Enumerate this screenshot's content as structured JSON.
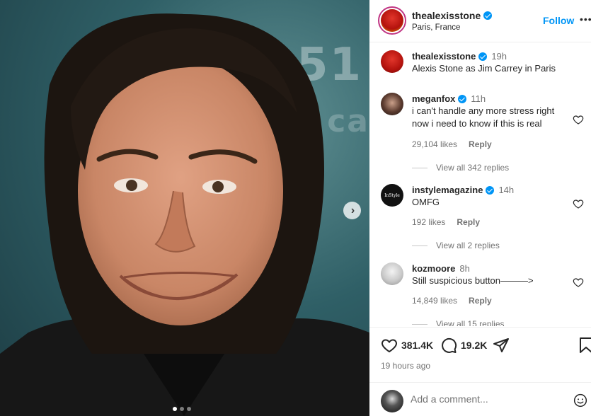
{
  "photo": {
    "background_text_1": "51",
    "background_text_2": "ca",
    "next_icon": "chevron-right-icon",
    "carousel": {
      "count": 3,
      "active_index": 0
    }
  },
  "header": {
    "username": "thealexisstone",
    "location": "Paris, France",
    "follow_label": "Follow",
    "more_label": "•••"
  },
  "caption": {
    "username": "thealexisstone",
    "time": "19h",
    "text": "Alexis Stone as Jim Carrey in Paris"
  },
  "comments": [
    {
      "username": "meganfox",
      "verified": true,
      "time": "11h",
      "text": "i can't handle any more stress right now i need to know if this is real",
      "likes": "29,104 likes",
      "reply_label": "Reply",
      "view_replies": "View all 342 replies"
    },
    {
      "username": "instylemagazine",
      "verified": true,
      "time": "14h",
      "text": "OMFG",
      "likes": "192 likes",
      "reply_label": "Reply",
      "view_replies": "View all 2 replies",
      "avatar_text": "InStyle"
    },
    {
      "username": "kozmoore",
      "verified": false,
      "time": "8h",
      "text": "Still suspicious button———>",
      "likes": "14,849 likes",
      "reply_label": "Reply",
      "view_replies": "View all 15 replies"
    }
  ],
  "actions": {
    "like_count": "381.4K",
    "comment_count": "19.2K",
    "posted_ago": "19 hours ago"
  },
  "add_comment": {
    "placeholder": "Add a comment..."
  },
  "colors": {
    "accent": "#0095f6",
    "text": "#262626",
    "muted": "#737373"
  }
}
